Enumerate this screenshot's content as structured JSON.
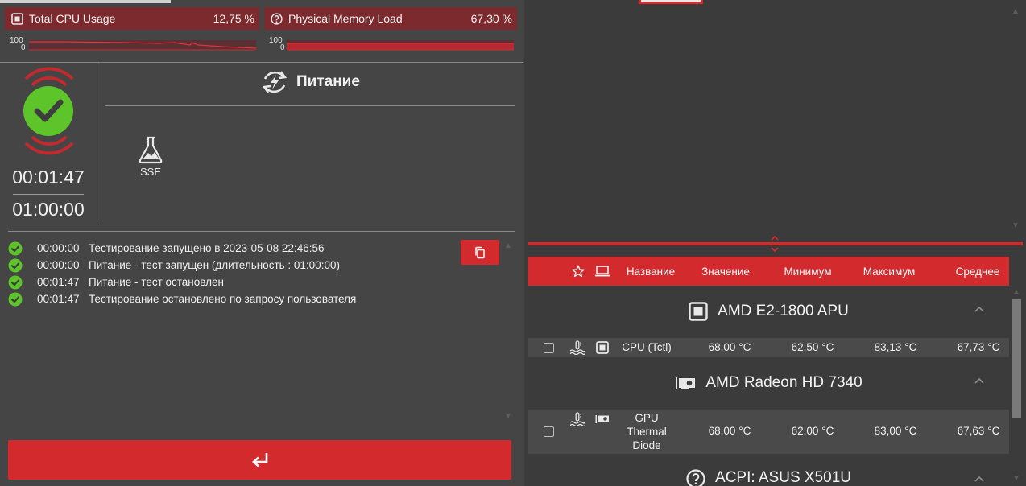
{
  "metrics": {
    "cpu": {
      "label": "Total CPU Usage",
      "value": "12,75 %",
      "icon": "cpu-chip-icon"
    },
    "memory": {
      "label": "Physical Memory Load",
      "value": "67,30 %",
      "icon": "question-circle-icon"
    }
  },
  "sparklines": {
    "cpu": {
      "max_label": "100",
      "min_label": "0",
      "level": 0.13
    },
    "memory": {
      "max_label": "100",
      "min_label": "0",
      "level": 0.67
    }
  },
  "status": {
    "icon": "check-circle-icon",
    "elapsed": "00:01:47",
    "duration": "01:00:00"
  },
  "test": {
    "title": "Питание",
    "title_icon": "power-cycle-icon",
    "items": [
      {
        "label": "SSE",
        "icon": "flask-icon"
      }
    ]
  },
  "log": [
    {
      "time": "00:00:00",
      "text": "Тестирование запущено в 2023-05-08 22:46:56"
    },
    {
      "time": "00:00:00",
      "text": "Питание - тест запущен (длительность : 01:00:00)"
    },
    {
      "time": "00:01:47",
      "text": "Питание - тест остановлен"
    },
    {
      "time": "00:01:47",
      "text": "Тестирование остановлено по запросу пользователя"
    }
  ],
  "buttons": {
    "copy_icon": "copy-icon",
    "enter_icon": "enter-arrow-icon"
  },
  "sensors": {
    "columns": [
      "Название",
      "Значение",
      "Минимум",
      "Максимум",
      "Среднее"
    ],
    "header_icons": [
      "star-icon",
      "laptop-icon"
    ],
    "groups": [
      {
        "name": "AMD E2-1800 APU",
        "icon": "cpu-chip-icon",
        "rows": [
          {
            "name": "CPU (Tctl)",
            "value": "68,00 °C",
            "min": "62,50 °C",
            "max": "83,13 °C",
            "avg": "67,73 °C",
            "icons": [
              "thermometer-icon",
              "cpu-chip-icon"
            ]
          }
        ]
      },
      {
        "name": "AMD Radeon HD 7340",
        "icon": "gpu-card-icon",
        "rows": [
          {
            "name": "GPU Thermal Diode",
            "value": "68,00 °C",
            "min": "62,00 °C",
            "max": "83,00 °C",
            "avg": "67,63 °C",
            "icons": [
              "thermometer-icon",
              "gpu-card-icon"
            ]
          }
        ]
      },
      {
        "name": "ACPI: ASUS X501U",
        "icon": "question-circle-icon",
        "rows": []
      }
    ]
  },
  "colors": {
    "accent": "#d32a2d",
    "metric_bg": "#7d2a2e",
    "ok_green": "#5dc42a",
    "panel": "#454545"
  }
}
